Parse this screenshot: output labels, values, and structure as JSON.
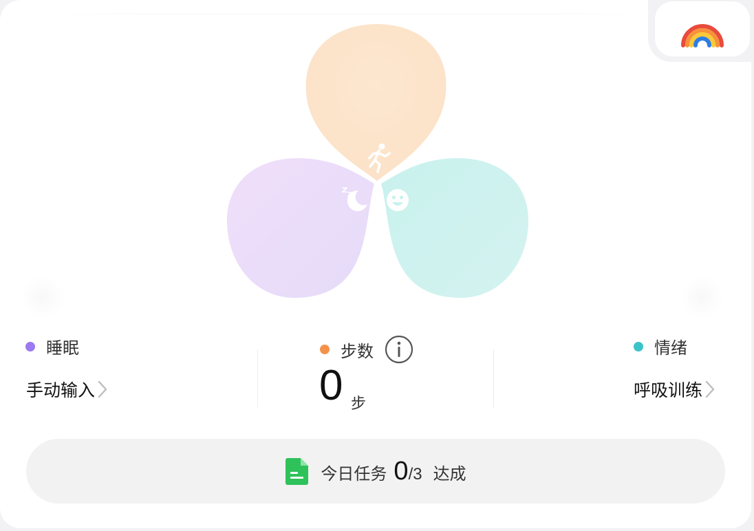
{
  "legend": {
    "sleep": {
      "label": "睡眠",
      "color": "#9d79f2"
    },
    "steps": {
      "label": "步数",
      "color": "#f5924a"
    },
    "mood": {
      "label": "情绪",
      "color": "#3cc3c9"
    }
  },
  "actions": {
    "sleep_link": "手动输入",
    "mood_link": "呼吸训练"
  },
  "steps": {
    "value": "0",
    "unit": "步"
  },
  "task": {
    "prefix": "今日任务",
    "done": "0",
    "total": "/3",
    "suffix": "达成"
  },
  "icons": {
    "app_logo": "rainbow-logo-icon",
    "steps_petal": "running-person-icon",
    "sleep_petal": "moon-zzz-icon",
    "mood_petal": "smiley-face-icon",
    "info": "info-icon",
    "chevron": "chevron-right-icon",
    "task": "document-icon"
  }
}
